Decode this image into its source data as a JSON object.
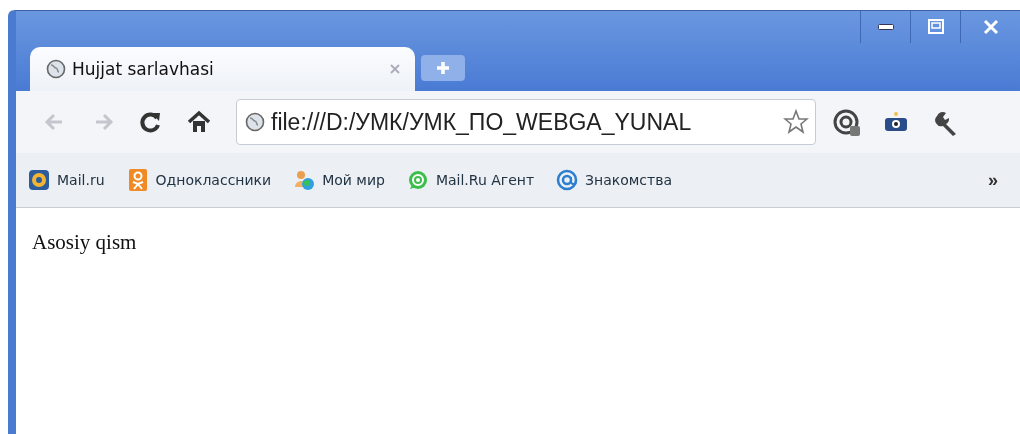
{
  "tabs": [
    {
      "title": "Hujjat sarlavhasi",
      "selected": true
    }
  ],
  "address_bar": {
    "value": "file:///D:/УМК/УМК_ПО_WEBGA_YUNAL"
  },
  "bookmarks": [
    {
      "label": "Mail.ru",
      "kind": "mail"
    },
    {
      "label": "Одноклассники",
      "kind": "ok"
    },
    {
      "label": "Мой мир",
      "kind": "people"
    },
    {
      "label": "Mail.Ru Агент",
      "kind": "agent"
    },
    {
      "label": "Знакомства",
      "kind": "at"
    }
  ],
  "bookmarks_overflow": "»",
  "page": {
    "text": "Asosiy qism"
  }
}
